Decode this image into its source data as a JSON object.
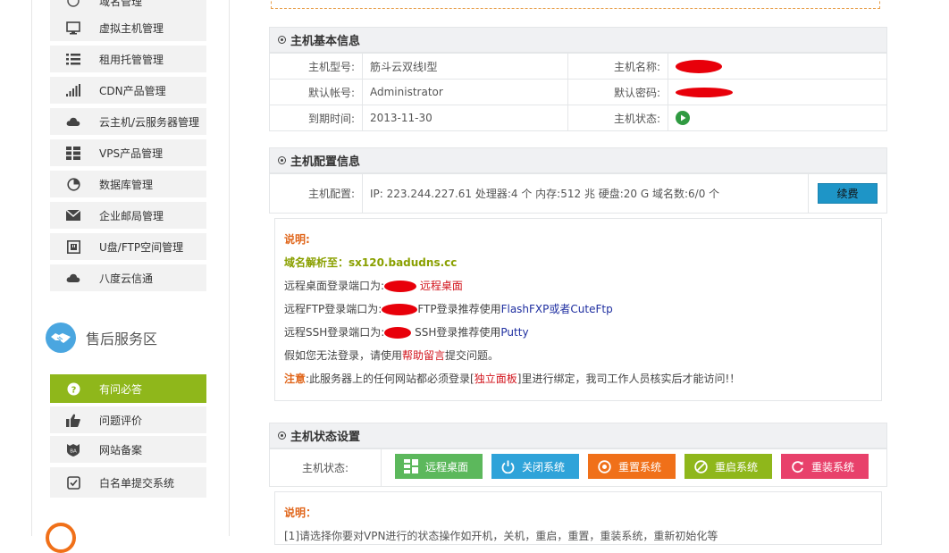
{
  "sidebar": {
    "items": [
      {
        "label": "域名管理",
        "icon": "globe-icon"
      },
      {
        "label": "虚拟主机管理",
        "icon": "monitor-icon"
      },
      {
        "label": "租用托管管理",
        "icon": "list-icon"
      },
      {
        "label": "CDN产品管理",
        "icon": "signal-bars-icon"
      },
      {
        "label": "云主机/云服务器管理",
        "icon": "cloud-icon"
      },
      {
        "label": "VPS产品管理",
        "icon": "grid-list-icon"
      },
      {
        "label": "数据库管理",
        "icon": "pie-icon"
      },
      {
        "label": "企业邮局管理",
        "icon": "envelope-icon"
      },
      {
        "label": "U盘/FTP空间管理",
        "icon": "usb-icon"
      },
      {
        "label": "八度云信通",
        "icon": "cloud-icon"
      }
    ],
    "aftersale": {
      "title": "售后服务区",
      "items": [
        {
          "label": "有问必答",
          "icon": "question-icon"
        },
        {
          "label": "问题评价",
          "icon": "thumbs-up-icon"
        },
        {
          "label": "网站备案",
          "icon": "badge-icon"
        },
        {
          "label": "白名单提交系统",
          "icon": "checkbox-icon"
        }
      ]
    }
  },
  "basic": {
    "title": "主机基本信息",
    "model_label": "主机型号:",
    "model_value": "筋斗云双线Ⅰ型",
    "name_label": "主机名称:",
    "account_label": "默认帐号:",
    "account_value": "Administrator",
    "password_label": "默认密码:",
    "expire_label": "到期时间:",
    "expire_value": "2013-11-30",
    "status_label": "主机状态:"
  },
  "config": {
    "title": "主机配置信息",
    "label": "主机配置:",
    "value": "IP: 223.244.227.61 处理器:4 个 内存:512 兆 硬盘:20 G 域名数:6/0 个",
    "renew_button": "续费"
  },
  "notes": {
    "title": "说明:",
    "domain_label": "域名解析至：sx120.badudns.cc",
    "rdp_prefix": "远程桌面登录端口为:",
    "rdp_link": "远程桌面",
    "ftp_prefix": "远程FTP登录端口为:",
    "ftp_mid": "FTP登录推荐使用",
    "ftp_tools": "FlashFXP或者CuteFtp",
    "ssh_prefix": "远程SSH登录端口为:",
    "ssh_mid": "SSH登录推荐使用",
    "ssh_tool": "Putty",
    "help_prefix": "假如您无法登录，请使用",
    "help_link": "帮助留言",
    "help_suffix": "提交问题。",
    "warn_label": "注意",
    "warn_prefix": ":此服务器上的任何网站都必须登录[",
    "warn_link": "独立面板",
    "warn_suffix": "]里进行绑定，我司工作人员核实后才能访问!！"
  },
  "status": {
    "title": "主机状态设置",
    "label": "主机状态:",
    "buttons": [
      {
        "label": "远程桌面",
        "color": "#5cb85c",
        "icon": "grid-icon"
      },
      {
        "label": "关闭系统",
        "color": "#2fa3d9",
        "icon": "power-icon"
      },
      {
        "label": "重置系统",
        "color": "#f07019",
        "icon": "target-icon"
      },
      {
        "label": "重启系统",
        "color": "#8fb71b",
        "icon": "cancel-circle-icon"
      },
      {
        "label": "重装系统",
        "color": "#e8416b",
        "icon": "refresh-icon"
      }
    ],
    "note_title": "说明：",
    "note_line": "[1]请选择你要对VPN进行的状态操作如开机，关机，重启，重置，重装系统，重新初始化等"
  },
  "colors": {
    "accent_green": "#8fb71b",
    "accent_blue": "#4aa6e0",
    "orange": "#e0661b"
  }
}
